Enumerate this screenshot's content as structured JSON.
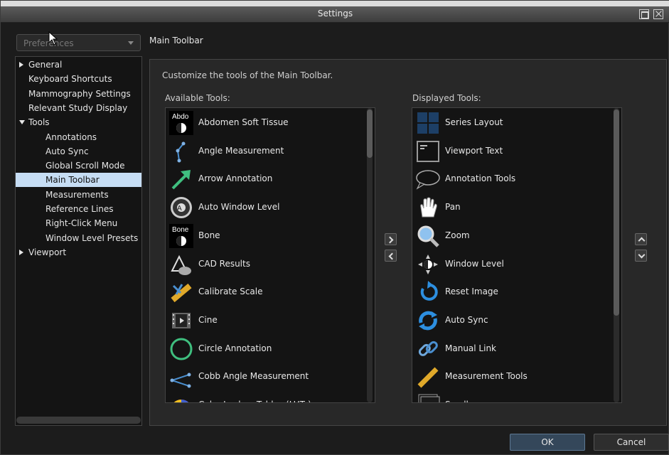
{
  "window": {
    "title": "Settings"
  },
  "search": {
    "placeholder": "Preferences"
  },
  "tree": {
    "items": [
      {
        "label": "General",
        "indent": 0,
        "expander": "right",
        "selected": false
      },
      {
        "label": "Keyboard Shortcuts",
        "indent": 1,
        "expander": "",
        "selected": false
      },
      {
        "label": "Mammography Settings",
        "indent": 1,
        "expander": "",
        "selected": false
      },
      {
        "label": "Relevant Study Display",
        "indent": 1,
        "expander": "",
        "selected": false
      },
      {
        "label": "Tools",
        "indent": 0,
        "expander": "down",
        "selected": false
      },
      {
        "label": "Annotations",
        "indent": 2,
        "expander": "",
        "selected": false
      },
      {
        "label": "Auto Sync",
        "indent": 2,
        "expander": "",
        "selected": false
      },
      {
        "label": "Global Scroll Mode",
        "indent": 2,
        "expander": "",
        "selected": false
      },
      {
        "label": "Main Toolbar",
        "indent": 2,
        "expander": "",
        "selected": true
      },
      {
        "label": "Measurements",
        "indent": 2,
        "expander": "",
        "selected": false
      },
      {
        "label": "Reference Lines",
        "indent": 2,
        "expander": "",
        "selected": false
      },
      {
        "label": "Right-Click Menu",
        "indent": 2,
        "expander": "",
        "selected": false
      },
      {
        "label": "Window Level Presets",
        "indent": 2,
        "expander": "",
        "selected": false
      },
      {
        "label": "Viewport",
        "indent": 0,
        "expander": "right",
        "selected": false
      }
    ]
  },
  "main": {
    "section_title": "Main Toolbar",
    "description": "Customize the tools of the Main Toolbar.",
    "available_label": "Available Tools:",
    "displayed_label": "Displayed Tools:",
    "available_tools": [
      {
        "label": "Abdomen Soft Tissue",
        "icon": "abdomen-preset-icon",
        "icon_text": "Abdo"
      },
      {
        "label": "Angle Measurement",
        "icon": "angle-icon"
      },
      {
        "label": "Arrow Annotation",
        "icon": "arrow-icon"
      },
      {
        "label": "Auto Window Level",
        "icon": "auto-window-level-icon"
      },
      {
        "label": "Bone",
        "icon": "bone-preset-icon",
        "icon_text": "Bone"
      },
      {
        "label": "CAD Results",
        "icon": "cad-icon"
      },
      {
        "label": "Calibrate Scale",
        "icon": "calibrate-icon"
      },
      {
        "label": "Cine",
        "icon": "cine-icon"
      },
      {
        "label": "Circle Annotation",
        "icon": "circle-icon"
      },
      {
        "label": "Cobb Angle Measurement",
        "icon": "cobb-angle-icon"
      },
      {
        "label": "Color Lookup Tables (LUTs)",
        "icon": "color-lut-icon"
      }
    ],
    "displayed_tools": [
      {
        "label": "Series Layout",
        "icon": "series-layout-icon"
      },
      {
        "label": "Viewport Text",
        "icon": "viewport-text-icon"
      },
      {
        "label": "Annotation Tools",
        "icon": "speech-bubble-icon"
      },
      {
        "label": "Pan",
        "icon": "hand-icon"
      },
      {
        "label": "Zoom",
        "icon": "magnifier-icon"
      },
      {
        "label": "Window Level",
        "icon": "window-level-icon"
      },
      {
        "label": "Reset Image",
        "icon": "reset-icon"
      },
      {
        "label": "Auto Sync",
        "icon": "sync-icon"
      },
      {
        "label": "Manual Link",
        "icon": "link-icon"
      },
      {
        "label": "Measurement Tools",
        "icon": "ruler-icon"
      },
      {
        "label": "Scroll",
        "icon": "scroll-icon"
      }
    ]
  },
  "buttons": {
    "ok": "OK",
    "cancel": "Cancel"
  },
  "colors": {
    "selection": "#c6ddf4",
    "accent_green": "#3fbf7f",
    "accent_blue": "#2d8fe0"
  }
}
